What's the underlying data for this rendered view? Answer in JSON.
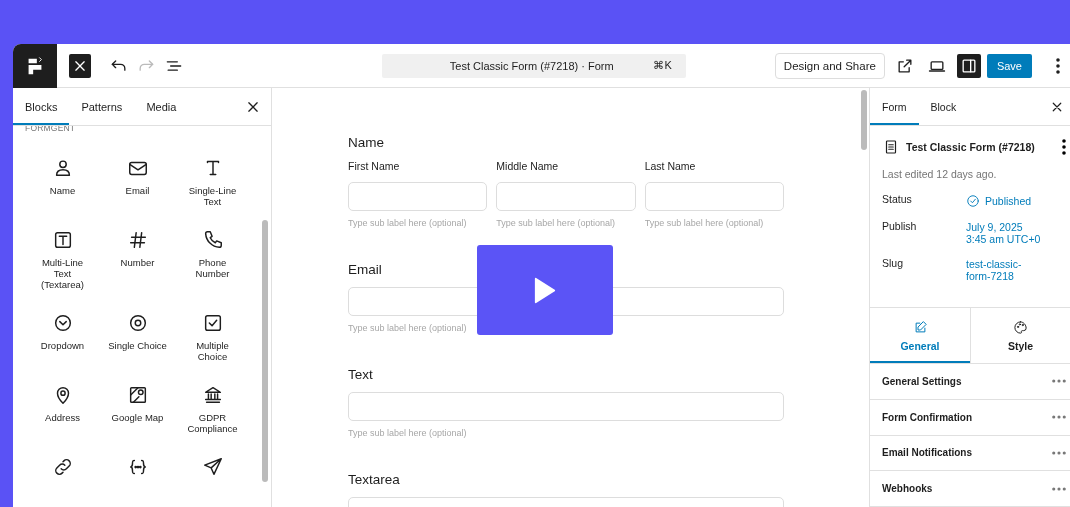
{
  "toolbar": {
    "left_buttons": [
      {
        "kind": "close",
        "disabled": false
      },
      {
        "kind": "undo",
        "disabled": false
      },
      {
        "kind": "redo",
        "disabled": true
      },
      {
        "kind": "outline",
        "disabled": false
      }
    ],
    "command_bar": {
      "title": "Test Classic Form (#7218) · Form",
      "shortcut": "⌘K"
    },
    "right_buttons": [
      {
        "kind": "text",
        "label": "Design and Share",
        "pressed": false
      },
      {
        "kind": "external",
        "pressed": false
      },
      {
        "kind": "preview",
        "pressed": false
      },
      {
        "kind": "sidebar",
        "pressed": true
      },
      {
        "kind": "primary",
        "label": "Save",
        "pressed": false
      },
      {
        "kind": "more",
        "pressed": false
      }
    ]
  },
  "inserter": {
    "tabs": [
      {
        "label": "Blocks",
        "selected": true
      },
      {
        "label": "Patterns",
        "selected": false
      },
      {
        "label": "Media",
        "selected": false
      }
    ],
    "category": "FORMGENT",
    "blocks": [
      {
        "label": "Name"
      },
      {
        "label": "Email"
      },
      {
        "label": "Single-Line\nText"
      },
      {
        "label": "Multi-Line\nText\n(Textarea)"
      },
      {
        "label": "Number"
      },
      {
        "label": "Phone\nNumber"
      },
      {
        "label": "Dropdown"
      },
      {
        "label": "Single Choice"
      },
      {
        "label": "Multiple\nChoice"
      },
      {
        "label": "Address"
      },
      {
        "label": "Google Map"
      },
      {
        "label": "GDPR\nCompliance"
      },
      {
        "kind": "unlabeled"
      },
      {
        "kind": "unlabeled"
      },
      {
        "kind": "unlabeled"
      }
    ]
  },
  "canvas": {
    "fields": [
      {
        "kind": "name",
        "label": "Name",
        "parts": [
          {
            "label": "First Name",
            "sub_label_placeholder": "Type sub label here (optional)"
          },
          {
            "label": "Middle Name",
            "sub_label_placeholder": "Type sub label here (optional)"
          },
          {
            "label": "Last Name",
            "sub_label_placeholder": "Type sub label here (optional)"
          }
        ]
      },
      {
        "kind": "input",
        "label": "Email",
        "sub_label_placeholder": "Type sub label here (optional)"
      },
      {
        "kind": "input",
        "label": "Text",
        "sub_label_placeholder": "Type sub label here (optional)"
      },
      {
        "kind": "textarea",
        "label": "Textarea"
      }
    ],
    "play_overlay": {
      "shown": true
    }
  },
  "sidebar": {
    "tabs": [
      {
        "label": "Form",
        "selected": true
      },
      {
        "label": "Block",
        "selected": false
      }
    ],
    "title": "Test Classic Form (#7218)",
    "last_edited": "Last edited 12 days ago.",
    "meta": [
      {
        "kind": "status",
        "label": "Status",
        "value": "Published"
      },
      {
        "kind": "link",
        "label": "Publish",
        "value": "July 9, 2025\n3:45 am UTC+0"
      },
      {
        "kind": "link",
        "label": "Slug",
        "value": "test-classic-\nform-7218"
      }
    ],
    "section_tabs": [
      {
        "label": "General",
        "selected": true
      },
      {
        "label": "Style",
        "selected": false
      }
    ],
    "sections": [
      "General Settings",
      "Form Confirmation",
      "Email Notifications",
      "Webhooks"
    ]
  }
}
